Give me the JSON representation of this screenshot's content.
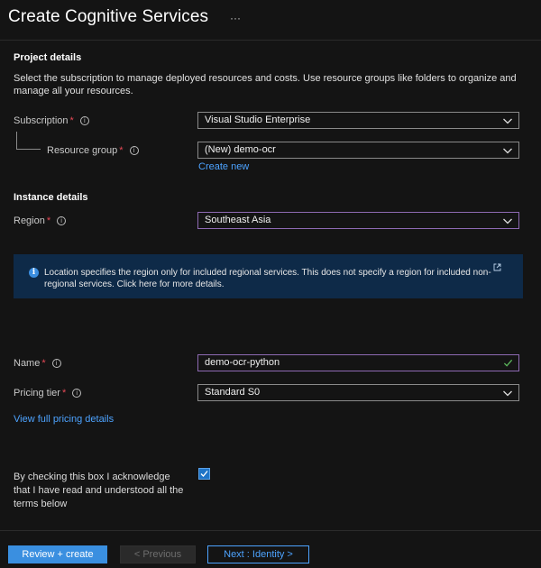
{
  "header": {
    "title": "Create Cognitive Services",
    "more": "···"
  },
  "project": {
    "heading": "Project details",
    "description": "Select the subscription to manage deployed resources and costs. Use resource groups like folders to organize and manage all your resources.",
    "subscription": {
      "label": "Subscription",
      "value": "Visual Studio Enterprise"
    },
    "resource_group": {
      "label": "Resource group",
      "value": "(New) demo-ocr",
      "create_new": "Create new"
    }
  },
  "instance": {
    "heading": "Instance details",
    "region": {
      "label": "Region",
      "value": "Southeast Asia"
    },
    "info_message": "Location specifies the region only for included regional services. This does not specify a region for included non-regional services. Click here for more details.",
    "name": {
      "label": "Name",
      "value": "demo-ocr-python"
    },
    "pricing_tier": {
      "label": "Pricing tier",
      "value": "Standard S0"
    },
    "pricing_link": "View full pricing details"
  },
  "terms": {
    "acknowledge": "By checking this box I acknowledge that I have read and understood all the terms below",
    "checked": true
  },
  "footer": {
    "review_create": "Review + create",
    "previous": "< Previous",
    "next": "Next : Identity >"
  },
  "colors": {
    "accent": "#3a8fe0",
    "link": "#4da3ff",
    "required": "#e74856",
    "valid": "#5cb85c",
    "info_bg": "#0e2a48"
  },
  "icons": {
    "info": "info-circle-icon",
    "chevron": "chevron-down-icon",
    "check": "checkmark-icon",
    "external": "external-link-icon"
  }
}
